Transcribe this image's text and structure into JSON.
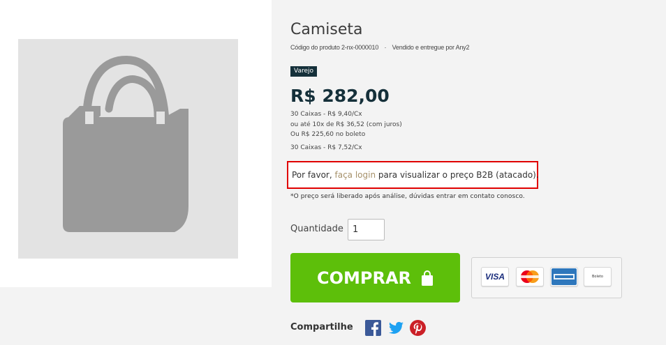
{
  "product": {
    "title": "Camiseta",
    "code_label": "Código do produto",
    "code": "2-nx-0000010",
    "seller_label": "Vendido e entregue por",
    "seller": "Any2",
    "badge": "Varejo",
    "price": "R$ 282,00",
    "lines": [
      "30 Caixas - R$ 9,40/Cx",
      "ou até 10x de R$ 36,52 (com juros)",
      "Ou R$ 225,60 no boleto",
      "30 Caixas - R$ 7,52/Cx"
    ]
  },
  "login_notice": {
    "before": "Por favor, ",
    "link": "faça login",
    "after": " para visualizar o preço B2B (atacado)."
  },
  "note": "*O preço será liberado após análise, dúvidas entrar em contato conosco.",
  "quantity": {
    "label": "Quantidade",
    "value": "1"
  },
  "buy_button": {
    "label": "COMPRAR"
  },
  "payment_methods": [
    {
      "name": "VISA",
      "icon": "visa-card-icon"
    },
    {
      "name": "MasterCard",
      "icon": "mastercard-icon"
    },
    {
      "name": "American Express",
      "icon": "amex-icon"
    },
    {
      "name": "Boleto",
      "icon": "boleto-icon"
    }
  ],
  "share": {
    "label": "Compartilhe",
    "networks": [
      "facebook-icon",
      "twitter-icon",
      "pinterest-icon"
    ]
  },
  "colors": {
    "buy_green": "#5dbf0a",
    "dark_teal": "#15303a",
    "link_tan": "#a6916a",
    "alert_red": "#e00000",
    "facebook": "#3b5998",
    "twitter": "#1da1f2",
    "pinterest": "#cb2027"
  }
}
